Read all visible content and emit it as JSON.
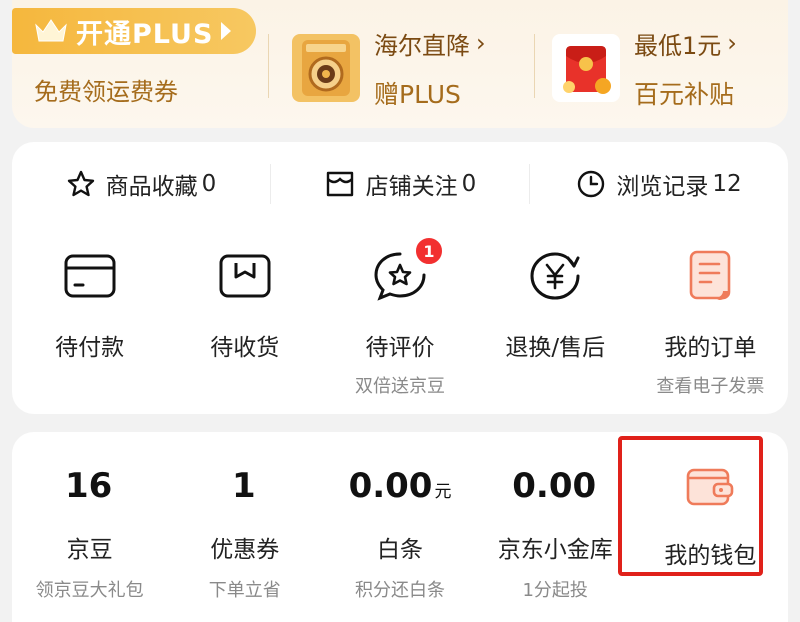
{
  "plus": {
    "badge_label": "开通PLUS",
    "subtitle": "免费领运费券"
  },
  "promos": [
    {
      "title": "海尔直降",
      "subtitle": "赠PLUS",
      "icon": "washing-machine-icon"
    },
    {
      "title": "最低1元",
      "subtitle": "百元补贴",
      "icon": "red-envelope-icon"
    }
  ],
  "stats": [
    {
      "label": "商品收藏",
      "count": "0",
      "icon": "star-icon"
    },
    {
      "label": "店铺关注",
      "count": "0",
      "icon": "store-icon"
    },
    {
      "label": "浏览记录",
      "count": "12",
      "icon": "clock-icon"
    }
  ],
  "orders": [
    {
      "label": "待付款",
      "sub": "",
      "icon": "wallet-card-icon"
    },
    {
      "label": "待收货",
      "sub": "",
      "icon": "package-icon"
    },
    {
      "label": "待评价",
      "sub": "双倍送京豆",
      "icon": "review-star-bubble-icon",
      "badge": "1"
    },
    {
      "label": "退换/售后",
      "sub": "",
      "icon": "yen-refund-icon"
    },
    {
      "label": "我的订单",
      "sub": "查看电子发票",
      "icon": "receipt-icon"
    }
  ],
  "assets": [
    {
      "value": "16",
      "unit": "",
      "label": "京豆",
      "sub": "领京豆大礼包"
    },
    {
      "value": "1",
      "unit": "",
      "label": "优惠券",
      "sub": "下单立省"
    },
    {
      "value": "0.00",
      "unit": "元",
      "label": "白条",
      "sub": "积分还白条"
    },
    {
      "value": "0.00",
      "unit": "",
      "label": "京东小金库",
      "sub": "1分起投"
    }
  ],
  "wallet": {
    "label": "我的钱包",
    "icon": "wallet-icon"
  },
  "colors": {
    "plus_gold": "#f5b73d",
    "accent_red": "#f23030",
    "highlight_red": "#e0211a",
    "icon_orange": "#ef7b5a"
  }
}
